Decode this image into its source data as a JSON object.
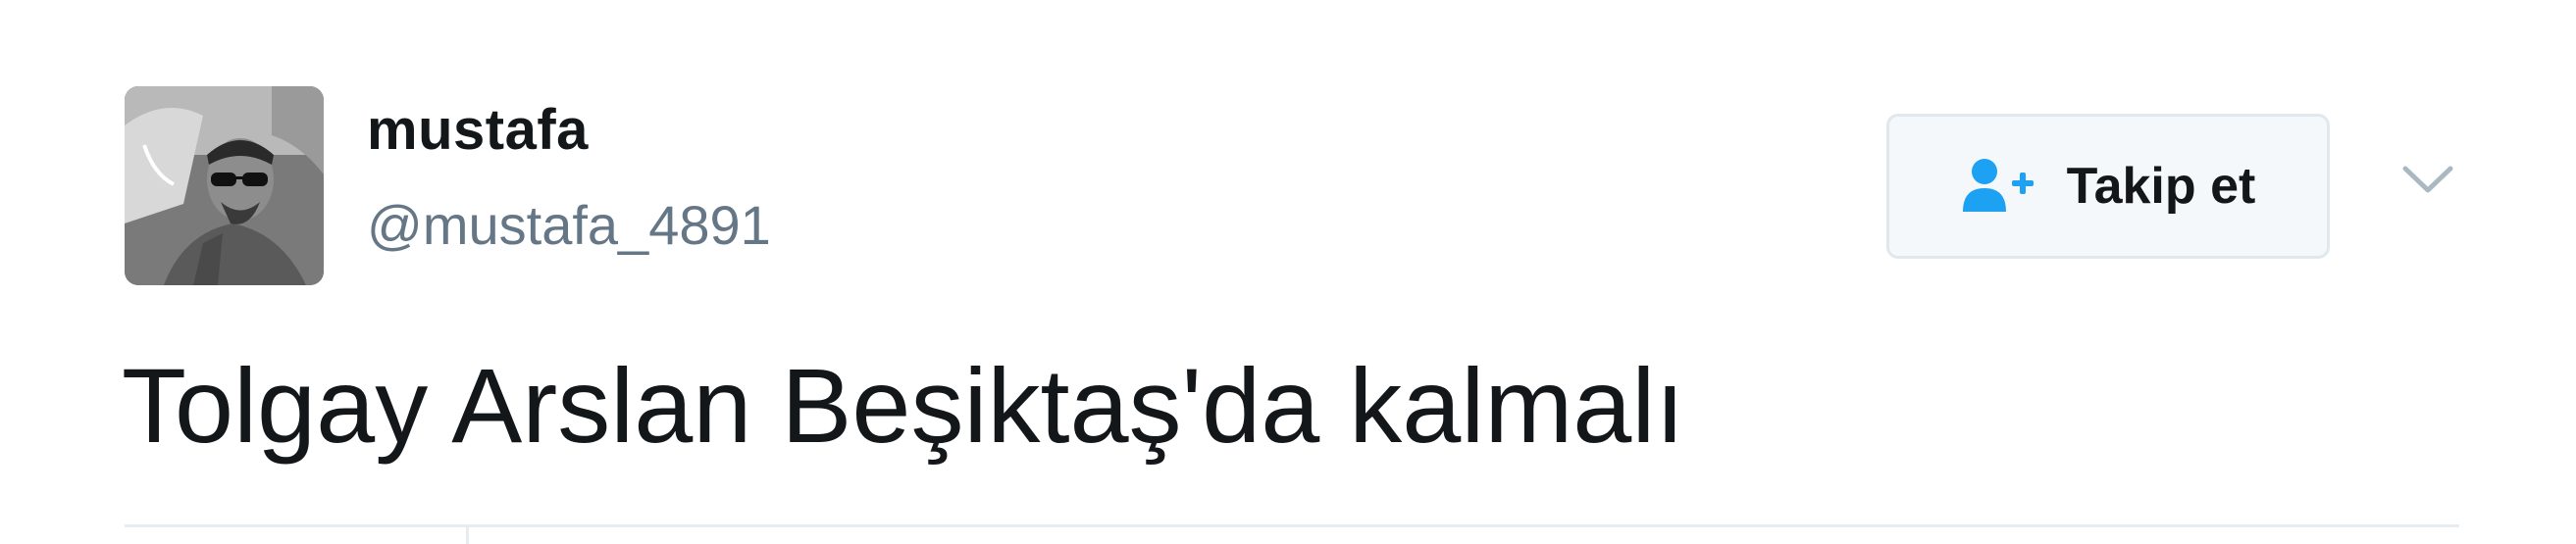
{
  "tweet": {
    "author": {
      "display_name": "mustafa",
      "handle": "@mustafa_4891"
    },
    "follow_button": {
      "label": "Takip et",
      "icon": "add-user-icon"
    },
    "menu_icon": "chevron-down-icon",
    "text": "Tolgay Arslan Beşiktaş'da kalmalı"
  },
  "colors": {
    "accent": "#1da1f2",
    "text": "#14171a",
    "secondary_text": "#657786",
    "button_bg": "#f5f8fa",
    "border": "#e1e8ed"
  }
}
